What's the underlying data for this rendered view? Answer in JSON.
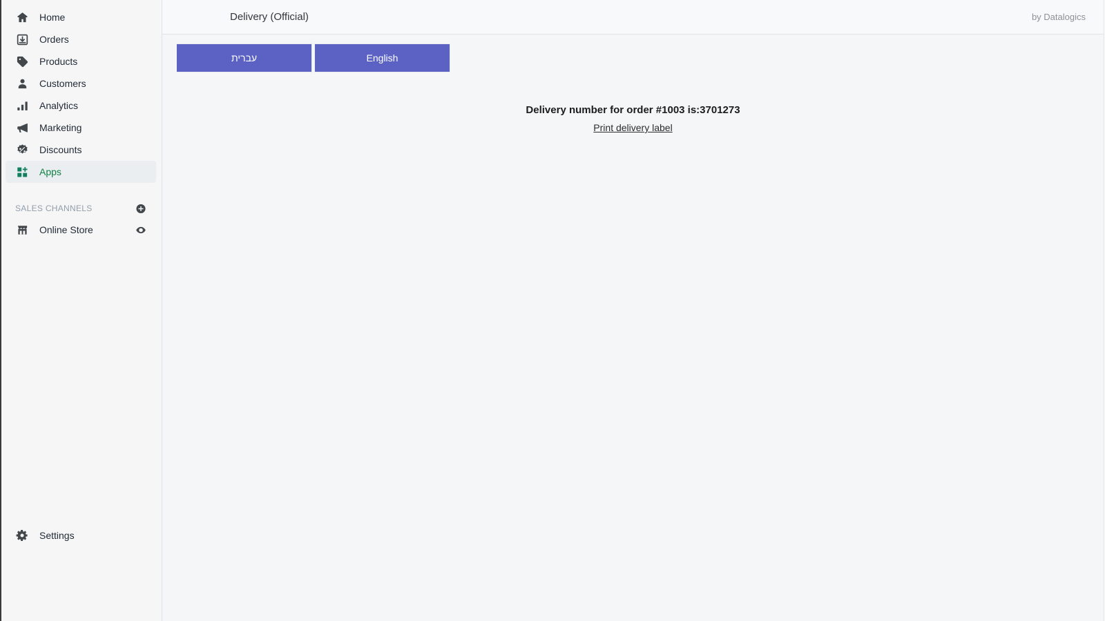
{
  "sidebar": {
    "items": [
      {
        "label": "Home",
        "icon": "home-icon",
        "active": false
      },
      {
        "label": "Orders",
        "icon": "orders-icon",
        "active": false
      },
      {
        "label": "Products",
        "icon": "products-icon",
        "active": false
      },
      {
        "label": "Customers",
        "icon": "customers-icon",
        "active": false
      },
      {
        "label": "Analytics",
        "icon": "analytics-icon",
        "active": false
      },
      {
        "label": "Marketing",
        "icon": "marketing-icon",
        "active": false
      },
      {
        "label": "Discounts",
        "icon": "discounts-icon",
        "active": false
      },
      {
        "label": "Apps",
        "icon": "apps-icon",
        "active": true
      }
    ],
    "sales_channels": {
      "title": "SALES CHANNELS",
      "add_icon": "plus-circle-icon",
      "channels": [
        {
          "label": "Online Store",
          "icon": "store-icon",
          "trailing_icon": "eye-icon"
        }
      ]
    },
    "settings": {
      "label": "Settings",
      "icon": "gear-icon"
    },
    "active_accent_color": "#108043",
    "icon_color": "#42474c",
    "background": "#f6f6f7"
  },
  "topbar": {
    "title": "Delivery (Official)",
    "credit": "by Datalogics"
  },
  "app_frame": {
    "language_buttons": [
      {
        "label": "עברית",
        "rtl": true
      },
      {
        "label": "English",
        "rtl": false
      }
    ],
    "button_color": "#5c62c4",
    "result": {
      "message": "Delivery number for order #1003 is:3701273",
      "order_number": "#1003",
      "delivery_number": "3701273",
      "print_link": "Print delivery label"
    }
  }
}
